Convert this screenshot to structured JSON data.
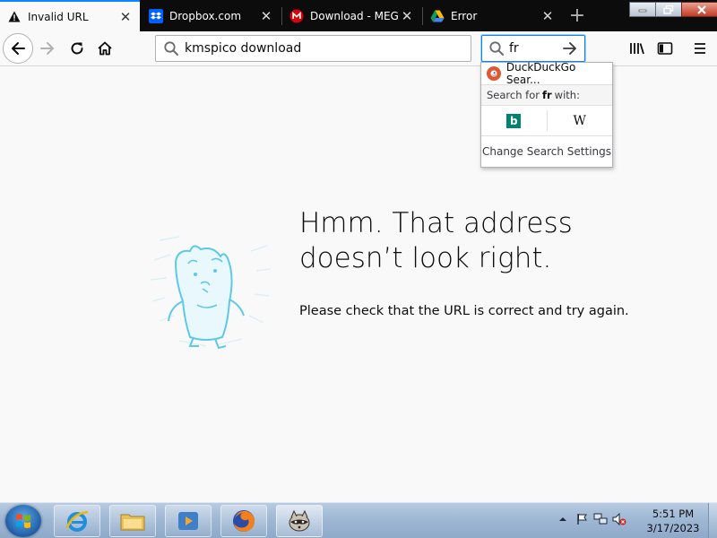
{
  "tabs": [
    {
      "title": "Invalid URL",
      "icon": "warning-icon",
      "active": true
    },
    {
      "title": "Dropbox.com",
      "icon": "dropbox-icon",
      "active": false
    },
    {
      "title": "Download - MEGA",
      "icon": "mega-icon",
      "active": false
    },
    {
      "title": "Error",
      "icon": "google-drive-icon",
      "active": false
    }
  ],
  "tab_close_glyph": "✕",
  "new_tab_glyph": "+",
  "urlbar": {
    "value": "kmspico download"
  },
  "searchbar": {
    "value": "fr"
  },
  "search_dropdown": {
    "engine_label": "DuckDuckGo Sear...",
    "search_for_prefix": "Search for",
    "search_term": "fr",
    "search_for_suffix": "with:",
    "alt_engines": [
      "bing-icon",
      "wikipedia-icon"
    ],
    "settings_label": "Change Search Settings"
  },
  "error_page": {
    "title_line1": "Hmm. That address",
    "title_line2": "doesn’t look right.",
    "description": "Please check that the URL is correct and try again."
  },
  "taskbar": {
    "pinned": [
      "internet-explorer-icon",
      "file-explorer-icon",
      "media-player-icon",
      "firefox-icon",
      "raccoon-app-icon"
    ],
    "clock_time": "5:51 PM",
    "clock_date": "3/17/2023"
  },
  "colors": {
    "accent": "#0a84ff",
    "tabbar_bg": "#0c0c0d",
    "page_bg": "#f9f9fa",
    "illustration": "#5ec8e8"
  }
}
